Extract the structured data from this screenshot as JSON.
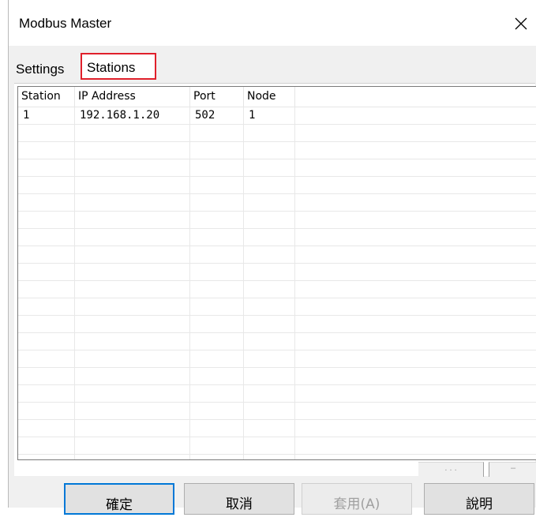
{
  "window": {
    "title": "Modbus Master"
  },
  "tabs": [
    {
      "label": "Settings"
    },
    {
      "label": "Stations"
    }
  ],
  "stations_table": {
    "columns": [
      "Station",
      "IP Address",
      "Port",
      "Node"
    ],
    "rows": [
      [
        "1",
        "192.168.1.20",
        "502",
        "1"
      ]
    ]
  },
  "dialog_buttons": {
    "ok": "確定",
    "cancel": "取消",
    "apply": "套用(A)",
    "help": "說明"
  },
  "hints": {
    "partial_left": ". . .",
    "partial_right": "–"
  },
  "colors": {
    "highlight_border": "#e0202b",
    "default_button_border": "#0078d7"
  }
}
